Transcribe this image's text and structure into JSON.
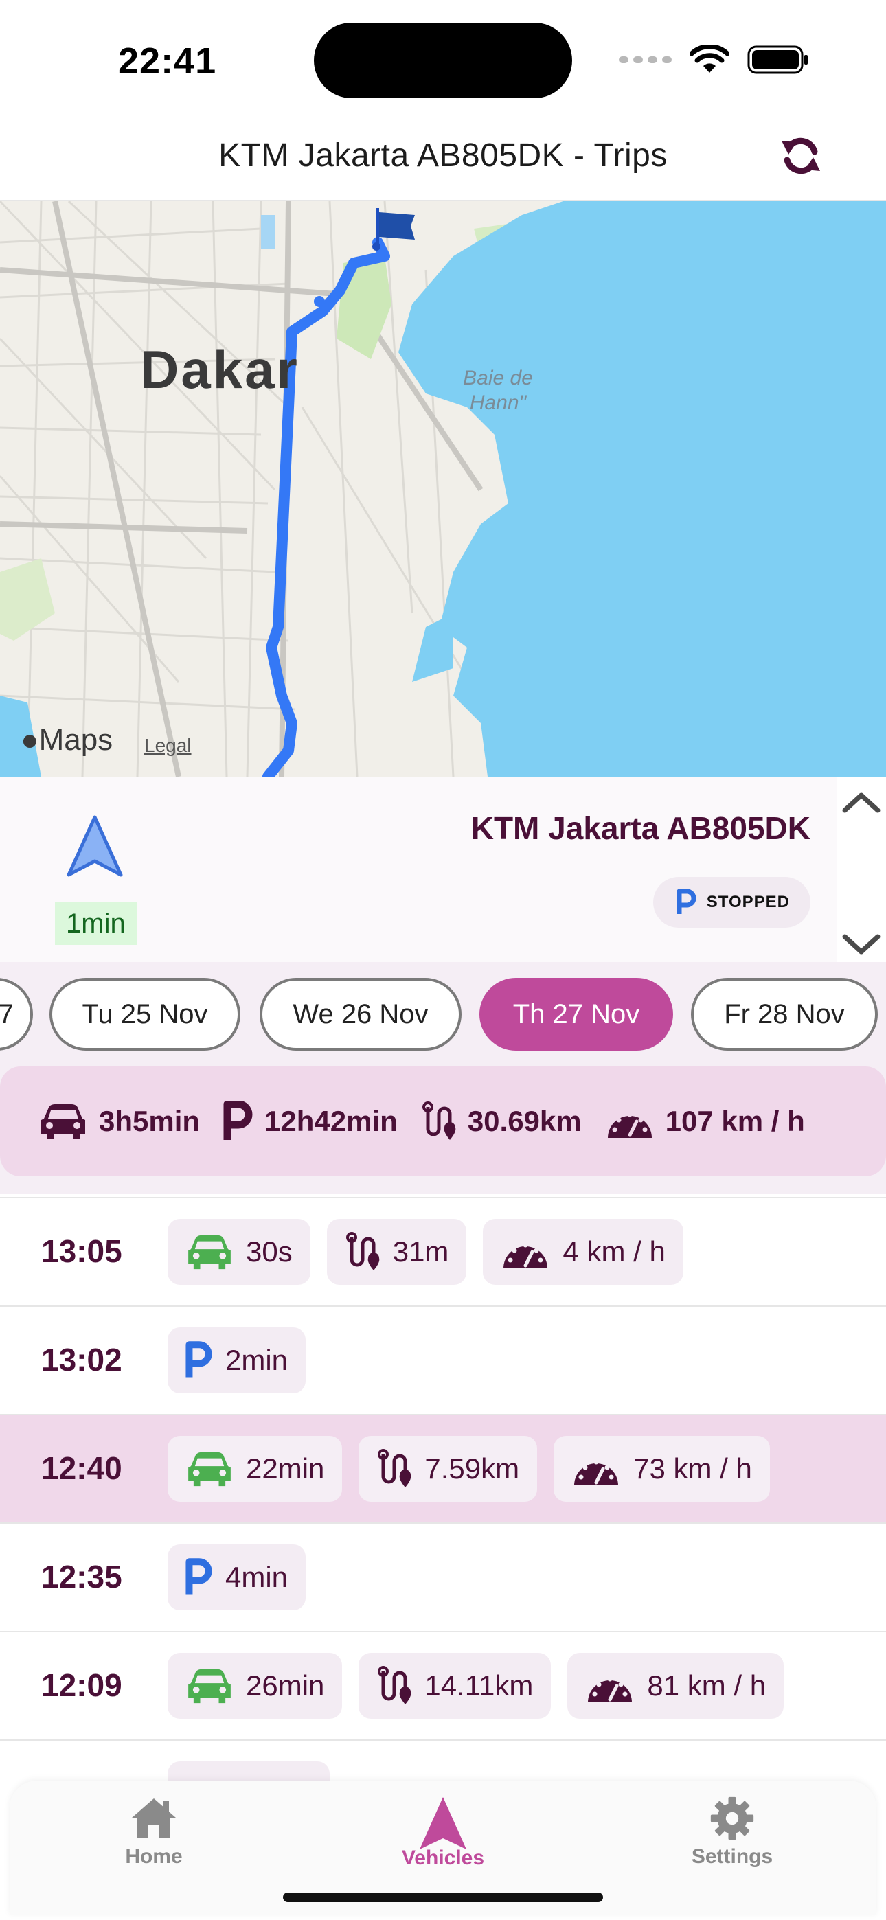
{
  "status_bar": {
    "time": "22:41"
  },
  "header": {
    "title": "KTM Jakarta AB805DK - Trips",
    "refresh_icon": "refresh-icon"
  },
  "map": {
    "city_label": "Dakar",
    "bay_label": "Baie de Hann\"",
    "attribution": "Maps",
    "legal_link": "Legal"
  },
  "vehicle_panel": {
    "nav_icon": "navigation-arrow-icon",
    "last_update": "1min",
    "vehicle_name": "KTM Jakarta AB805DK",
    "status_label": "STOPPED",
    "status_icon": "parking-icon"
  },
  "dates": [
    {
      "label": "7",
      "active": false
    },
    {
      "label": "Tu 25 Nov",
      "active": false
    },
    {
      "label": "We 26 Nov",
      "active": false
    },
    {
      "label": "Th 27 Nov",
      "active": true
    },
    {
      "label": "Fr 28 Nov",
      "active": false
    }
  ],
  "summary": {
    "driving_time": "3h5min",
    "parked_time": "12h42min",
    "distance": "30.69km",
    "max_speed": "107 km / h"
  },
  "trips": [
    {
      "time": "13:05",
      "type": "drive",
      "duration": "30s",
      "distance": "31m",
      "speed": "4 km / h"
    },
    {
      "time": "13:02",
      "type": "park",
      "duration": "2min"
    },
    {
      "time": "12:40",
      "type": "drive",
      "duration": "22min",
      "distance": "7.59km",
      "speed": "73 km / h",
      "selected": true
    },
    {
      "time": "12:35",
      "type": "park",
      "duration": "4min"
    },
    {
      "time": "12:09",
      "type": "drive",
      "duration": "26min",
      "distance": "14.11km",
      "speed": "81 km / h"
    }
  ],
  "tabbar": {
    "home": "Home",
    "vehicles": "Vehicles",
    "settings": "Settings",
    "active": "vehicles"
  },
  "colors": {
    "accent": "#bf4a9b",
    "text_primary": "#4a1037",
    "drive_green": "#4caf50",
    "park_blue": "#2f6fe0",
    "route_blue": "#3478f6",
    "water": "#7fcff3"
  }
}
